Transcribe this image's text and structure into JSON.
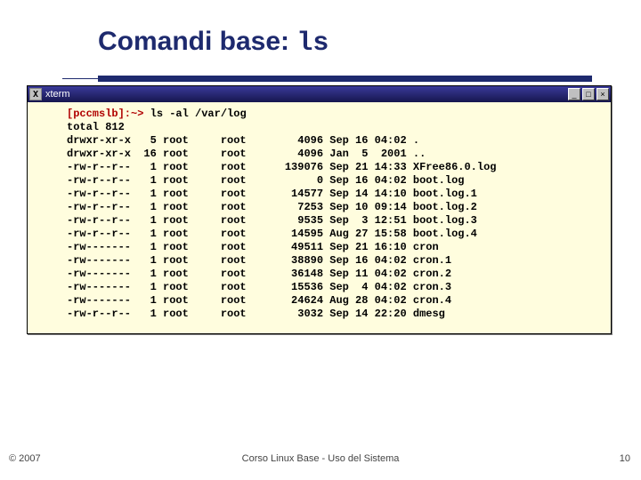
{
  "title_part1": "Comandi base: ",
  "title_cmd": "ls",
  "xterm": {
    "icon_glyph": "X",
    "title": "xterm",
    "btn_min": "_",
    "btn_max": "□",
    "btn_close": "×"
  },
  "prompt": "[pccmslb]:~> ",
  "command": "ls -al /var/log",
  "total_line": "total 812",
  "rows": [
    {
      "perm": "drwxr-xr-x",
      "n": "5",
      "own": "root",
      "grp": "root",
      "size": "4096",
      "mon": "Sep",
      "day": "16",
      "time": "04:02",
      "name": "."
    },
    {
      "perm": "drwxr-xr-x",
      "n": "16",
      "own": "root",
      "grp": "root",
      "size": "4096",
      "mon": "Jan",
      "day": "5",
      "time": "2001",
      "name": ".."
    },
    {
      "perm": "-rw-r--r--",
      "n": "1",
      "own": "root",
      "grp": "root",
      "size": "139076",
      "mon": "Sep",
      "day": "21",
      "time": "14:33",
      "name": "XFree86.0.log"
    },
    {
      "perm": "-rw-r--r--",
      "n": "1",
      "own": "root",
      "grp": "root",
      "size": "0",
      "mon": "Sep",
      "day": "16",
      "time": "04:02",
      "name": "boot.log"
    },
    {
      "perm": "-rw-r--r--",
      "n": "1",
      "own": "root",
      "grp": "root",
      "size": "14577",
      "mon": "Sep",
      "day": "14",
      "time": "14:10",
      "name": "boot.log.1"
    },
    {
      "perm": "-rw-r--r--",
      "n": "1",
      "own": "root",
      "grp": "root",
      "size": "7253",
      "mon": "Sep",
      "day": "10",
      "time": "09:14",
      "name": "boot.log.2"
    },
    {
      "perm": "-rw-r--r--",
      "n": "1",
      "own": "root",
      "grp": "root",
      "size": "9535",
      "mon": "Sep",
      "day": "3",
      "time": "12:51",
      "name": "boot.log.3"
    },
    {
      "perm": "-rw-r--r--",
      "n": "1",
      "own": "root",
      "grp": "root",
      "size": "14595",
      "mon": "Aug",
      "day": "27",
      "time": "15:58",
      "name": "boot.log.4"
    },
    {
      "perm": "-rw-------",
      "n": "1",
      "own": "root",
      "grp": "root",
      "size": "49511",
      "mon": "Sep",
      "day": "21",
      "time": "16:10",
      "name": "cron"
    },
    {
      "perm": "-rw-------",
      "n": "1",
      "own": "root",
      "grp": "root",
      "size": "38890",
      "mon": "Sep",
      "day": "16",
      "time": "04:02",
      "name": "cron.1"
    },
    {
      "perm": "-rw-------",
      "n": "1",
      "own": "root",
      "grp": "root",
      "size": "36148",
      "mon": "Sep",
      "day": "11",
      "time": "04:02",
      "name": "cron.2"
    },
    {
      "perm": "-rw-------",
      "n": "1",
      "own": "root",
      "grp": "root",
      "size": "15536",
      "mon": "Sep",
      "day": "4",
      "time": "04:02",
      "name": "cron.3"
    },
    {
      "perm": "-rw-------",
      "n": "1",
      "own": "root",
      "grp": "root",
      "size": "24624",
      "mon": "Aug",
      "day": "28",
      "time": "04:02",
      "name": "cron.4"
    },
    {
      "perm": "-rw-r--r--",
      "n": "1",
      "own": "root",
      "grp": "root",
      "size": "3032",
      "mon": "Sep",
      "day": "14",
      "time": "22:20",
      "name": "dmesg"
    }
  ],
  "copyright": "© 2007",
  "footer": "Corso Linux Base - Uso del Sistema",
  "page": "10"
}
